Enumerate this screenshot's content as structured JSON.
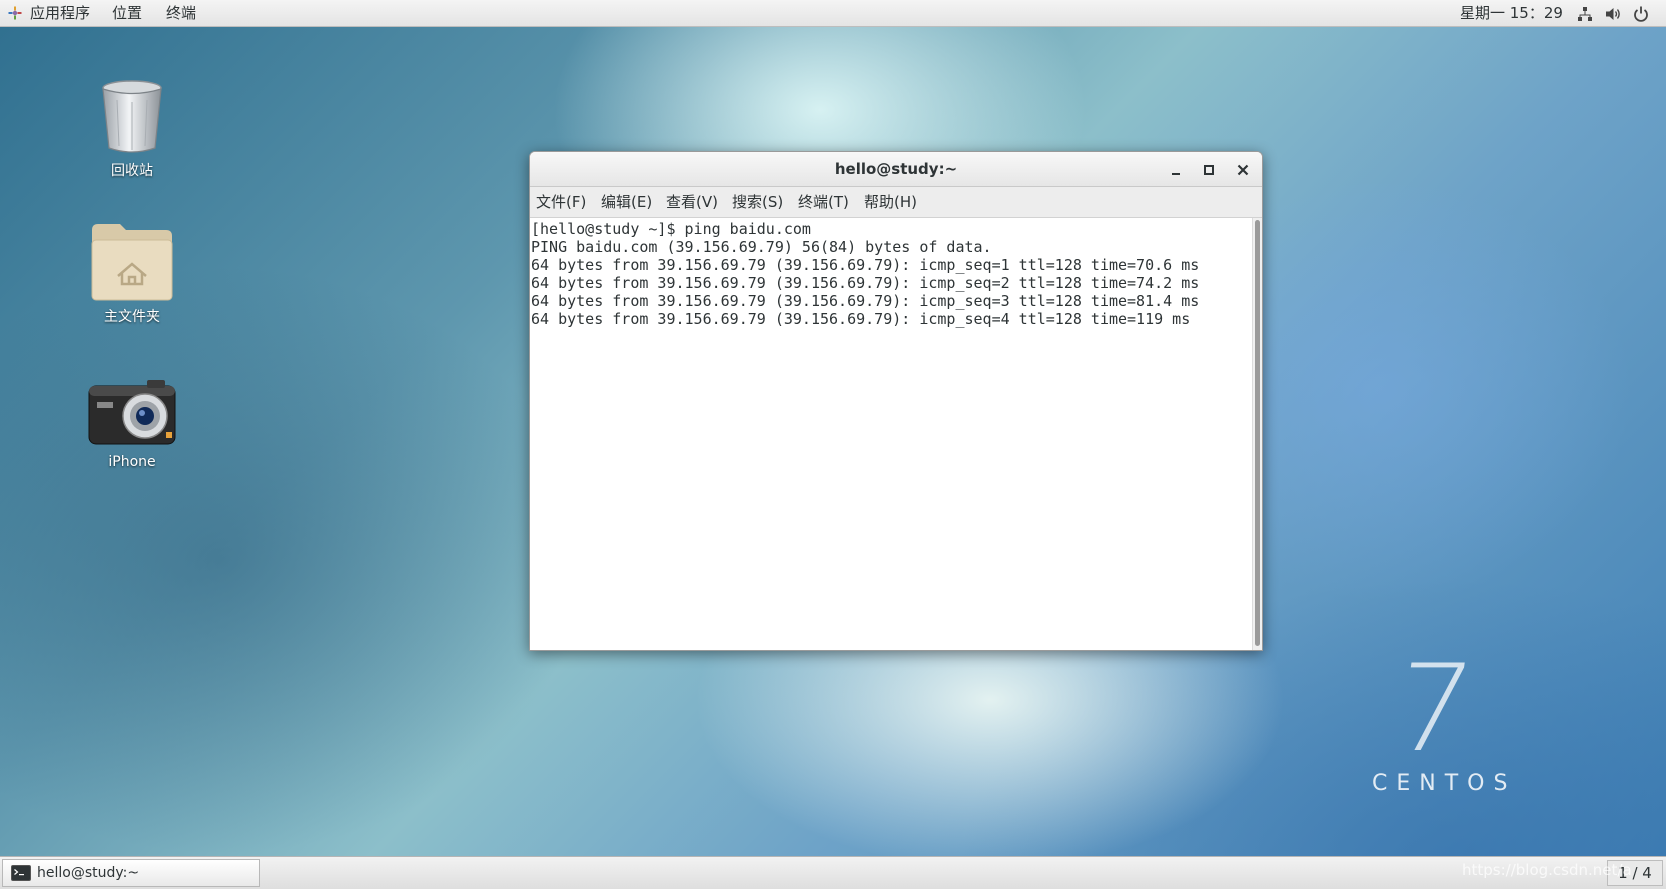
{
  "topbar": {
    "apps_label": "应用程序",
    "places_label": "位置",
    "terminal_label": "终端",
    "clock": "星期一 15：29",
    "tray_icons": [
      "network-icon",
      "volume-icon",
      "power-icon"
    ]
  },
  "desktop_icons": [
    {
      "label": "回收站",
      "icon": "trash-icon"
    },
    {
      "label": "主文件夹",
      "icon": "home-folder-icon"
    },
    {
      "label": "iPhone",
      "icon": "camera-icon"
    }
  ],
  "window": {
    "title": "hello@study:~",
    "buttons": [
      "minimize",
      "maximize",
      "close"
    ],
    "menus": [
      "文件(F)",
      "编辑(E)",
      "查看(V)",
      "搜索(S)",
      "终端(T)",
      "帮助(H)"
    ],
    "terminal_lines": [
      "[hello@study ~]$ ping baidu.com",
      "PING baidu.com (39.156.69.79) 56(84) bytes of data.",
      "64 bytes from 39.156.69.79 (39.156.69.79): icmp_seq=1 ttl=128 time=70.6 ms",
      "64 bytes from 39.156.69.79 (39.156.69.79): icmp_seq=2 ttl=128 time=74.2 ms",
      "64 bytes from 39.156.69.79 (39.156.69.79): icmp_seq=3 ttl=128 time=81.4 ms",
      "64 bytes from 39.156.69.79 (39.156.69.79): icmp_seq=4 ttl=128 time=119 ms"
    ]
  },
  "logo": {
    "version": "7",
    "name": "CENTOS"
  },
  "taskbar": {
    "task_label": "hello@study:~",
    "workspace": "1 / 4",
    "watermark": "https://blog.csdn.net/a"
  }
}
